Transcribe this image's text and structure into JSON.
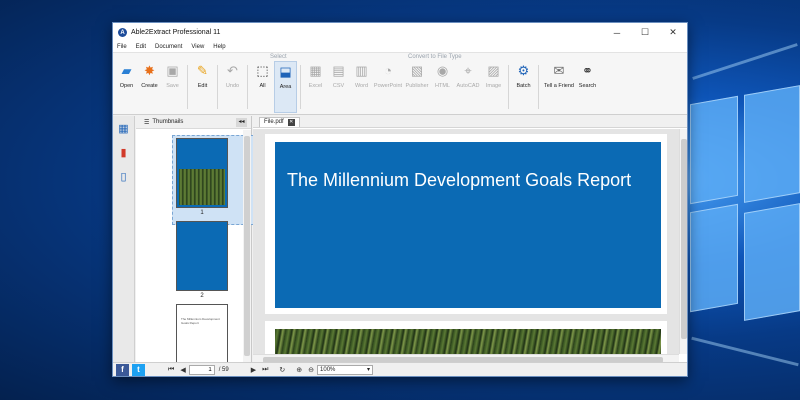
{
  "window": {
    "title": "Able2Extract Professional 11",
    "minimize": "─",
    "maximize": "☐",
    "close": "✕"
  },
  "menu": [
    "File",
    "Edit",
    "Document",
    "View",
    "Help"
  ],
  "ribbon": {
    "select_label": "Select",
    "convert_label": "Convert to File Type",
    "tools": {
      "open": "Open",
      "create": "Create",
      "save": "Save",
      "edit": "Edit",
      "undo": "Undo",
      "all": "All",
      "area": "Area",
      "excel": "Excel",
      "csv": "CSV",
      "word": "Word",
      "powerpoint": "PowerPoint",
      "publisher": "Publisher",
      "html": "HTML",
      "autocad": "AutoCAD",
      "image": "Image",
      "batch": "Batch",
      "tell_friend": "Tell a Friend",
      "search": "Search"
    }
  },
  "sidebar": {
    "panel_title": "Thumbnails",
    "collapse": "◂◂"
  },
  "thumbnails": [
    {
      "number": "1",
      "selected": true
    },
    {
      "number": "2",
      "selected": false
    }
  ],
  "thumb3_title": "The Millennium Development Goals Report",
  "document": {
    "tab_name": "File.pdf",
    "tab_close": "✕",
    "cover_title": "The Millennium Development Goals Report",
    "cover_color": "#0b6ab4"
  },
  "statusbar": {
    "current_page": "1",
    "total_pages": "/ 59",
    "zoom": "100%"
  },
  "colors": {
    "facebook": "#3b5998",
    "twitter": "#1da1f2",
    "accent": "#0b6ab4"
  }
}
